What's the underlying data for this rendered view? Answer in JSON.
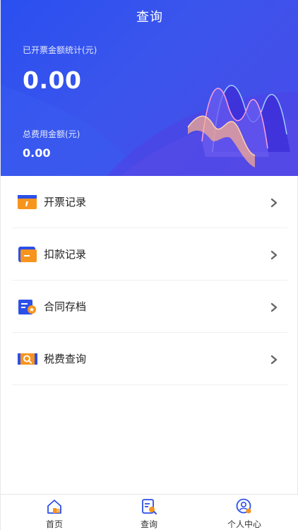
{
  "header": {
    "title": "查询",
    "invoice_total_label": "已开票金额统计(元)",
    "invoice_total_value": "0.00",
    "fee_total_label": "总费用金额(元)",
    "fee_total_value": "0.00"
  },
  "menu": {
    "items": [
      {
        "label": "开票记录",
        "icon": "invoice-icon"
      },
      {
        "label": "扣款记录",
        "icon": "wallet-icon"
      },
      {
        "label": "合同存档",
        "icon": "contract-icon"
      },
      {
        "label": "税费查询",
        "icon": "tax-search-icon"
      }
    ]
  },
  "tabbar": {
    "items": [
      {
        "label": "首页",
        "icon": "home-icon"
      },
      {
        "label": "查询",
        "icon": "query-icon"
      },
      {
        "label": "个人中心",
        "icon": "profile-icon"
      }
    ]
  },
  "colors": {
    "header_blue": "#2f4fee",
    "icon_orange": "#f7941d",
    "icon_blue": "#2c4fe8"
  }
}
